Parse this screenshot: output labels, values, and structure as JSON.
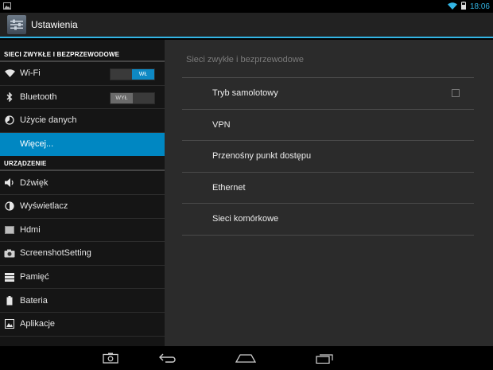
{
  "status_bar": {
    "time": "18:06",
    "icons": [
      "image-notification-icon",
      "wifi-icon",
      "battery-icon"
    ]
  },
  "action_bar": {
    "title": "Ustawienia",
    "icon": "settings-app-icon"
  },
  "left_pane": {
    "section_wireless": "SIECI ZWYKŁE I BEZPRZEWODOWE",
    "wifi": {
      "label": "Wi-Fi",
      "toggle": "WŁ",
      "icon": "wifi-icon"
    },
    "bluetooth": {
      "label": "Bluetooth",
      "toggle": "WYŁ",
      "icon": "bluetooth-icon"
    },
    "data_usage": {
      "label": "Użycie danych",
      "icon": "data-usage-icon"
    },
    "more": {
      "label": "Więcej..."
    },
    "section_device": "URZĄDZENIE",
    "sound": {
      "label": "Dźwięk",
      "icon": "speaker-icon"
    },
    "display": {
      "label": "Wyświetlacz",
      "icon": "brightness-icon"
    },
    "hdmi": {
      "label": "Hdmi",
      "icon": "hdmi-icon"
    },
    "screenshot": {
      "label": "ScreenshotSetting",
      "icon": "camera-icon"
    },
    "storage": {
      "label": "Pamięć",
      "icon": "storage-icon"
    },
    "battery": {
      "label": "Bateria",
      "icon": "battery-icon"
    },
    "apps": {
      "label": "Aplikacje",
      "icon": "apps-icon"
    }
  },
  "right_pane": {
    "title": "Sieci zwykłe i bezprzewodowe",
    "rows": [
      {
        "label": "Tryb samolotowy"
      },
      {
        "label": "VPN"
      },
      {
        "label": "Przenośny punkt dostępu"
      },
      {
        "label": "Ethernet"
      },
      {
        "label": "Sieci komórkowe"
      }
    ]
  },
  "nav_bar": {
    "buttons": [
      "screenshot-button",
      "back-button",
      "home-button",
      "recents-button"
    ]
  },
  "colors": {
    "accent": "#33b5e5",
    "selected": "#0087c2",
    "left_bg": "#151515",
    "right_bg": "#2b2b2b"
  }
}
